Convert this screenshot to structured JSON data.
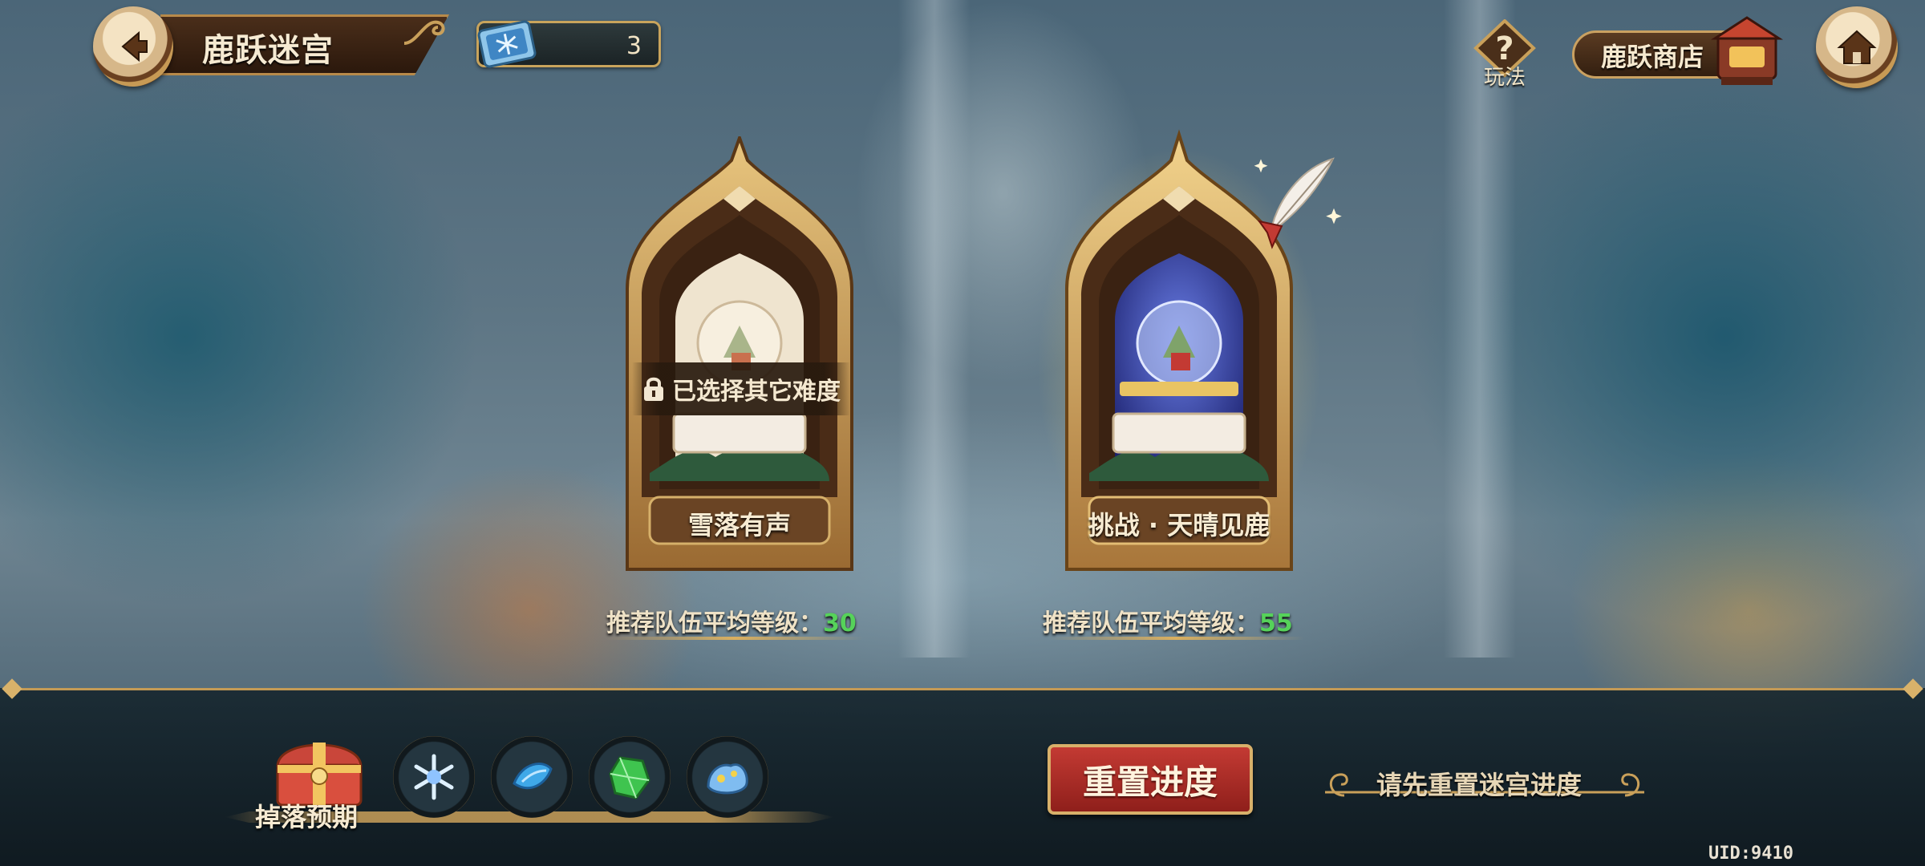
{
  "header": {
    "title": "鹿跃迷宫",
    "ticket_count": "3",
    "help_label": "玩法",
    "shop_label": "鹿跃商店"
  },
  "difficulties": [
    {
      "name": "雪落有声",
      "locked": true,
      "lock_text": "已选择其它难度",
      "rec_prefix": "推荐队伍平均等级：",
      "rec_level": "30"
    },
    {
      "name": "挑战 · 天晴见鹿",
      "locked": false,
      "rec_prefix": "推荐队伍平均等级：",
      "rec_level": "55"
    }
  ],
  "drops": {
    "label": "掉落预期",
    "items": [
      "snowflake-crystal-icon",
      "blue-gem-icon",
      "green-crystal-icon",
      "ice-ore-icon"
    ]
  },
  "actions": {
    "reset_label": "重置进度",
    "hint": "请先重置迷宫进度"
  },
  "uid": "UID:9410",
  "colors": {
    "accent_gold": "#c9a45c",
    "reset_red": "#b8312b",
    "level_green": "#56d25a"
  }
}
